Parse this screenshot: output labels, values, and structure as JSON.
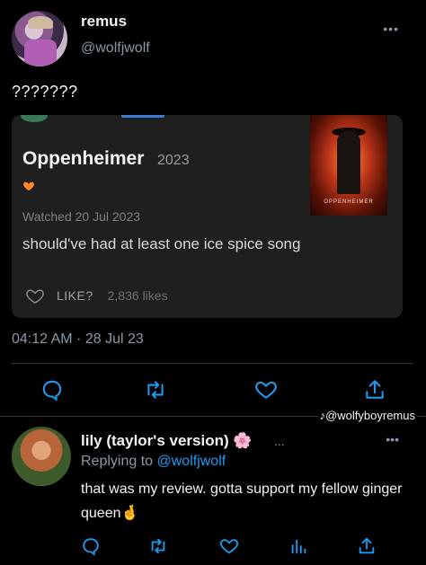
{
  "tweet": {
    "display_name": "remus",
    "handle": "@wolfjwolf",
    "more_label": "•••",
    "text": "???????",
    "timestamp": "04:12 AM · 28 Jul 23"
  },
  "card": {
    "film_title": "Oppenheimer",
    "film_year": "2023",
    "watched": "Watched 20 Jul 2023",
    "review": "should've had at least one ice spice song",
    "like_label": "LIKE?",
    "likes_count": "2,836 likes",
    "poster_title": "OPPENHEIMER",
    "colors": {
      "heart_rating": "#ff8a2a",
      "card_bg": "#1f1f1f"
    }
  },
  "watermark": "♪@wolfyboyremus",
  "reply": {
    "display_name": "lily (taylor's version) 🌸",
    "inline_more": "...",
    "more_label": "•••",
    "replying_prefix": "Replying to ",
    "replying_handle": "@wolfjwolf",
    "text": "that was my review. gotta support my fellow ginger queen🤞"
  },
  "icons": {
    "actions_main": [
      "reply-icon",
      "retweet-icon",
      "like-icon",
      "share-icon"
    ],
    "actions_reply": [
      "reply-icon",
      "retweet-icon",
      "like-icon",
      "views-icon",
      "share-icon"
    ]
  },
  "colors": {
    "background": "#000000",
    "secondary_text": "#8b98a5",
    "link": "#1d9bf0"
  }
}
